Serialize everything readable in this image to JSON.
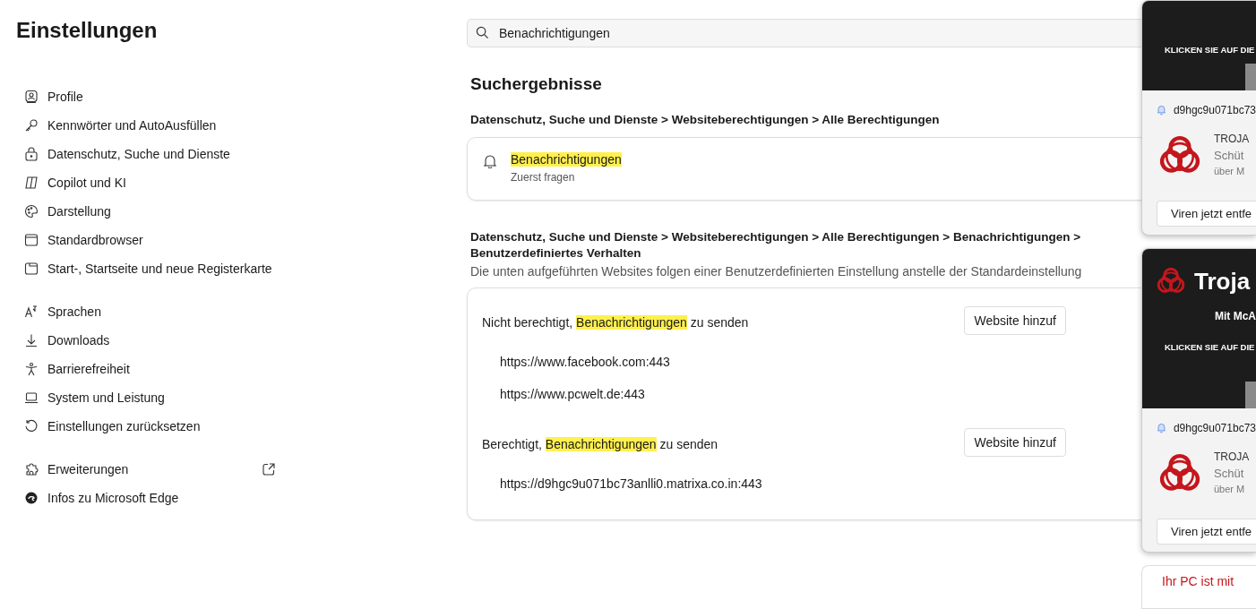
{
  "sidebar": {
    "title": "Einstellungen",
    "groups": [
      [
        {
          "label": "Profile",
          "selected": false,
          "external": false
        },
        {
          "label": "Kennwörter und AutoAusfüllen",
          "selected": false,
          "external": false
        },
        {
          "label": "Datenschutz, Suche und Dienste",
          "selected": false,
          "external": false
        },
        {
          "label": "Copilot und KI",
          "selected": false,
          "external": false
        },
        {
          "label": "Darstellung",
          "selected": false,
          "external": false
        },
        {
          "label": "Standardbrowser",
          "selected": false,
          "external": false
        },
        {
          "label": "Start-, Startseite und neue Registerkarte",
          "selected": false,
          "external": false
        }
      ],
      [
        {
          "label": "Sprachen",
          "selected": false,
          "external": false
        },
        {
          "label": "Downloads",
          "selected": false,
          "external": false
        },
        {
          "label": "Barrierefreiheit",
          "selected": false,
          "external": false
        },
        {
          "label": "System und Leistung",
          "selected": false,
          "external": false
        },
        {
          "label": "Einstellungen zurücksetzen",
          "selected": false,
          "external": false
        }
      ],
      [
        {
          "label": "Erweiterungen",
          "selected": false,
          "external": true
        },
        {
          "label": "Infos zu Microsoft Edge",
          "selected": false,
          "external": false
        }
      ]
    ]
  },
  "search": {
    "value": "Benachrichtigungen"
  },
  "results": {
    "title": "Suchergebnisse",
    "breadcrumb": "Datenschutz, Suche und Dienste > Websiteberechtigungen > Alle Berechtigungen",
    "result": {
      "title": "Benachrichtigungen",
      "subtitle": "Zuerst fragen"
    },
    "breadcrumb_2": "Datenschutz, Suche und Dienste > Websiteberechtigungen > Alle Berechtigungen > Benachrichtigungen > Benutzerdefiniertes Verhalten",
    "description": "Die unten aufgeführten Websites folgen einer Benutzerdefinierten Einstellung anstelle der Standardeinstellung",
    "sections": [
      {
        "label_parts": [
          {
            "text": "Nicht berechtigt, ",
            "highlight": false
          },
          {
            "text": "Benachrichtigungen",
            "highlight": true
          },
          {
            "text": " zu senden",
            "highlight": false
          }
        ],
        "button": "Website hinzuf",
        "sites": [
          "https://www.facebook.com:443",
          "https://www.pcwelt.de:443"
        ]
      },
      {
        "label_parts": [
          {
            "text": "Berechtigt, ",
            "highlight": false
          },
          {
            "text": "Benachrichtigungen",
            "highlight": true
          },
          {
            "text": " zu senden",
            "highlight": false
          }
        ],
        "button": "Website hinzuf",
        "sites": [
          "https://d9hgc9u071bc73anlli0.matrixa.co.in:443"
        ]
      }
    ]
  },
  "notifications": [
    {
      "banner_cta": "KLICKEN SIE AUF DIE",
      "source": "d9hgc9u071bc73",
      "title": "TROJA",
      "body": "Schüt",
      "attribution": "über M",
      "button": "Viren jetzt entfe"
    },
    {
      "banner_title": "Troja",
      "banner_line": "Mit McA",
      "banner_cta": "KLICKEN SIE AUF DIE",
      "source": "d9hgc9u071bc73",
      "title": "TROJA",
      "body": "Schüt",
      "attribution": "über M",
      "button": "Viren jetzt entfe"
    }
  ],
  "bottom_notice": "Ihr PC ist mit"
}
